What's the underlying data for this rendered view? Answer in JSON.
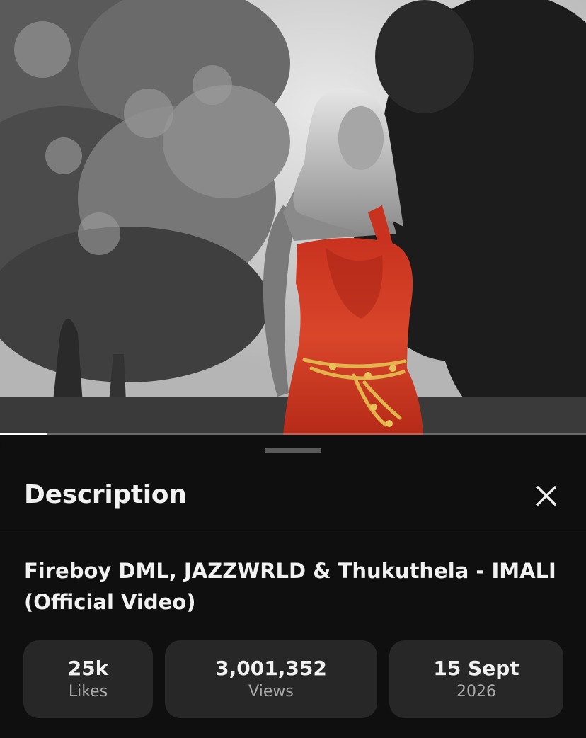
{
  "video": {
    "progress_fraction": 0.08
  },
  "sheet": {
    "title": "Description",
    "close_icon": "close-icon"
  },
  "description": {
    "video_title": "Fireboy DML, JAZZWRLD & Thukuthela - IMALI (Official Video)",
    "stats": [
      {
        "value": "25k",
        "label": "Likes"
      },
      {
        "value": "3,001,352",
        "label": "Views"
      },
      {
        "value": "15 Sept",
        "label": "2026"
      }
    ]
  }
}
